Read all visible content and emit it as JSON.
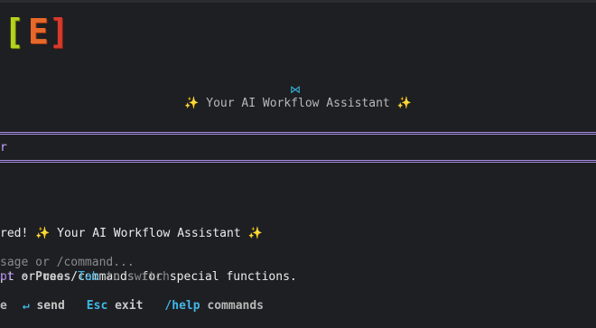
{
  "logo": {
    "glyph_left": "[",
    "glyph_mid": "E",
    "glyph_right": "]",
    "colors": [
      "#b6d31c",
      "#e7692a",
      "#d83a2c"
    ]
  },
  "header": {
    "icon": "bowtie-icon",
    "icon_glyph": "⋈",
    "subtitle_sparkle_left": "✨",
    "subtitle_text": " Your AI Workflow Assistant ",
    "subtitle_sparkle_right": "✨"
  },
  "input": {
    "prompt_fragment": "r",
    "border_color": "#a98ee6"
  },
  "welcome": {
    "line1_prefix": "red! ",
    "line1_sparkle_left": "✨",
    "line1_text": " Your AI Workflow Assistant ",
    "line1_sparkle_right": "✨",
    "line2": "pt or use /commands for special functions."
  },
  "composer": {
    "placeholder": "sage or /command...",
    "mode_label": "or",
    "separator": " • ",
    "press_label": "Press",
    "tab_key": "Tab",
    "switch_text": " to switch"
  },
  "footer": {
    "edge_char": "e",
    "send_icon": "↵",
    "send_label": "send",
    "esc_key": "Esc",
    "exit_label": "exit",
    "help_key": "/help",
    "help_label": "commands"
  },
  "colors": {
    "background": "#1e1f22",
    "accent_purple": "#a98ee6",
    "key_blue": "#41b6e6",
    "sparkle": "#f1c94a"
  }
}
